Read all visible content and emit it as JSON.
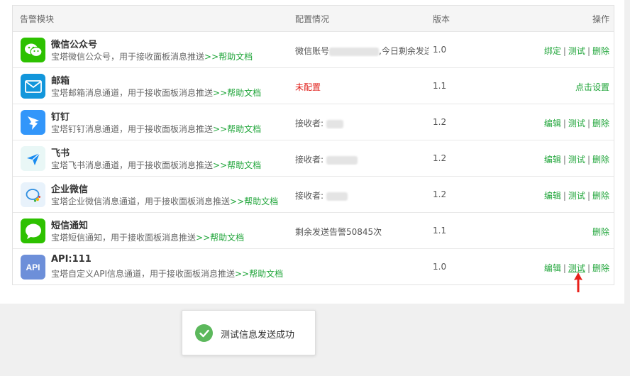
{
  "table": {
    "headers": {
      "module": "告警模块",
      "config": "配置情况",
      "version": "版本",
      "actions": "操作"
    },
    "help_text": ">>帮助文档",
    "rows": [
      {
        "name": "微信公众号",
        "desc": "宝塔微信公众号，用于接收面板消息推送",
        "icon": "wechat-official-icon",
        "config_prefix": "微信账号",
        "config_suffix": ",今日剩余发送",
        "version": "1.0",
        "actions": [
          "绑定",
          "测试",
          "删除"
        ]
      },
      {
        "name": "邮箱",
        "desc": "宝塔邮箱消息通道，用于接收面板消息推送",
        "icon": "mail-icon",
        "config_text": "未配置",
        "version": "1.1",
        "actions": [
          "点击设置"
        ]
      },
      {
        "name": "钉钉",
        "desc": "宝塔钉钉消息通道，用于接收面板消息推送",
        "icon": "dingtalk-icon",
        "config_prefix": "接收者: ",
        "version": "1.2",
        "actions": [
          "编辑",
          "测试",
          "删除"
        ]
      },
      {
        "name": "飞书",
        "desc": "宝塔飞书消息通道，用于接收面板消息推送",
        "icon": "feishu-icon",
        "config_prefix": "接收者: ",
        "version": "1.2",
        "actions": [
          "编辑",
          "测试",
          "删除"
        ]
      },
      {
        "name": "企业微信",
        "desc": "宝塔企业微信消息通道，用于接收面板消息推送",
        "icon": "wecom-icon",
        "config_prefix": "接收者: ",
        "version": "1.2",
        "actions": [
          "编辑",
          "测试",
          "删除"
        ]
      },
      {
        "name": "短信通知",
        "desc": "宝塔短信通知，用于接收面板消息推送",
        "icon": "sms-icon",
        "config_text": "剩余发送告警50845次",
        "version": "1.1",
        "actions": [
          "删除"
        ]
      },
      {
        "name": "API:111",
        "desc": "宝塔自定义API信息通道，用于接收面板消息推送",
        "icon": "api-icon",
        "icon_text": "API",
        "version": "1.0",
        "actions": [
          "编辑",
          "测试",
          "删除"
        ]
      }
    ]
  },
  "toast": {
    "text": "测试信息发送成功",
    "icon": "check-circle-icon"
  },
  "colors": {
    "accent": "#20a53a",
    "error": "#e0201b",
    "wechat": "#2dc100",
    "mail": "#1296db",
    "dingtalk": "#3296fa",
    "api": "#6d8fd9",
    "arrow": "#e8211b"
  }
}
